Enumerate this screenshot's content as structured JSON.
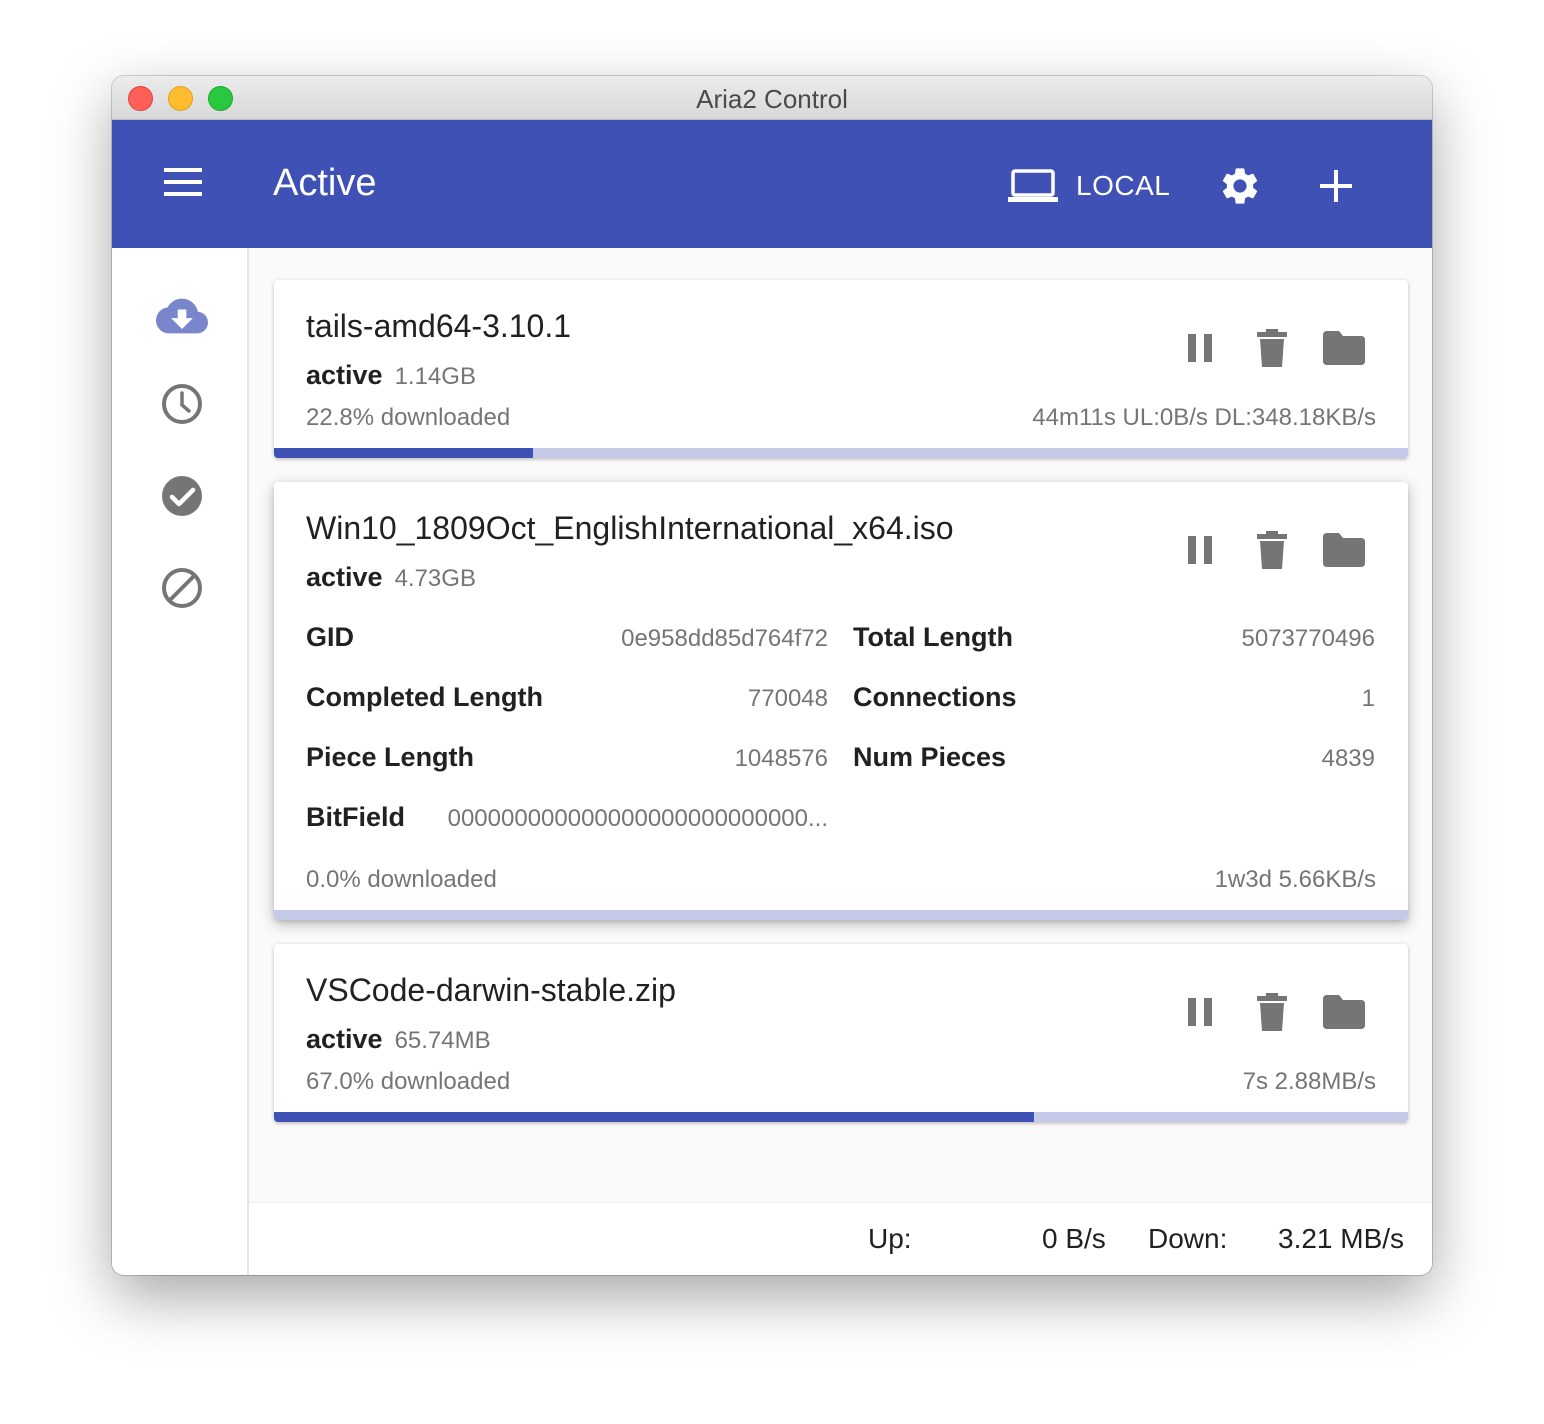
{
  "window": {
    "title": "Aria2 Control"
  },
  "appbar": {
    "title": "Active",
    "server_label": "LOCAL",
    "icons": {
      "menu": "menu-icon",
      "server": "laptop-icon",
      "settings": "gear-icon",
      "add": "plus-icon"
    }
  },
  "sidebar": {
    "items": [
      {
        "name": "active",
        "icon": "cloud-download-icon",
        "selected": true
      },
      {
        "name": "waiting",
        "icon": "clock-icon",
        "selected": false
      },
      {
        "name": "completed",
        "icon": "check-circle-icon",
        "selected": false
      },
      {
        "name": "stopped",
        "icon": "block-icon",
        "selected": false
      }
    ]
  },
  "downloads": [
    {
      "name": "tails-amd64-3.10.1",
      "status": "active",
      "size": "1.14GB",
      "percent_text": "22.8% downloaded",
      "speed_text": "44m11s UL:0B/s DL:348.18KB/s",
      "progress": 0.228
    },
    {
      "name": "Win10_1809Oct_EnglishInternational_x64.iso",
      "status": "active",
      "size": "4.73GB",
      "percent_text": "0.0% downloaded",
      "speed_text": "1w3d 5.66KB/s",
      "progress": 0.0,
      "details": {
        "gid_label": "GID",
        "gid": "0e958dd85d764f72",
        "total_length_label": "Total Length",
        "total_length": "5073770496",
        "completed_length_label": "Completed Length",
        "completed_length": "770048",
        "connections_label": "Connections",
        "connections": "1",
        "piece_length_label": "Piece Length",
        "piece_length": "1048576",
        "num_pieces_label": "Num Pieces",
        "num_pieces": "4839",
        "bitfield_label": "BitField",
        "bitfield": "000000000000000000000000000..."
      }
    },
    {
      "name": "VSCode-darwin-stable.zip",
      "status": "active",
      "size": "65.74MB",
      "percent_text": "67.0% downloaded",
      "speed_text": "7s 2.88MB/s",
      "progress": 0.67
    }
  ],
  "actions": {
    "pause": "pause-icon",
    "delete": "trash-icon",
    "folder": "folder-icon"
  },
  "statusbar": {
    "up_label": "Up:",
    "up_value": "0 B/s",
    "down_label": "Down:",
    "down_value": "3.21 MB/s"
  },
  "colors": {
    "primary": "#3f51b5",
    "progress_track": "#c5cae9",
    "active_icon": "#7986cb",
    "icon_grey": "#757575"
  }
}
